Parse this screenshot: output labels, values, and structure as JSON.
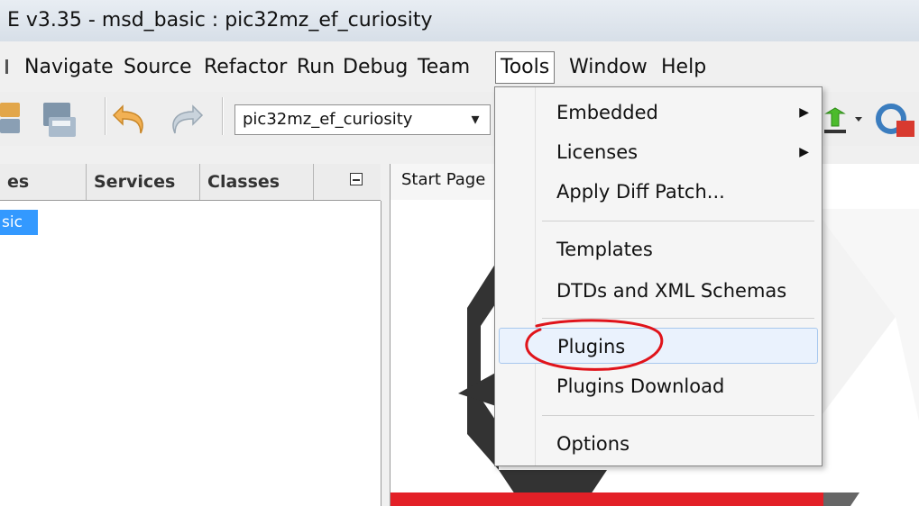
{
  "window": {
    "title": "E v3.35 - msd_basic : pic32mz_ef_curiosity"
  },
  "menubar": {
    "items": [
      {
        "label": "Navigate"
      },
      {
        "label": "Source"
      },
      {
        "label": "Refactor"
      },
      {
        "label": "Run"
      },
      {
        "label": "Debug"
      },
      {
        "label": "Team"
      },
      {
        "label": "Tools"
      },
      {
        "label": "Window"
      },
      {
        "label": "Help"
      }
    ],
    "active": "Tools"
  },
  "toolbar": {
    "configuration_value": "pic32mz_ef_curiosity",
    "configuration_arrow": "▾"
  },
  "left_panel": {
    "tabs": [
      {
        "label": "es"
      },
      {
        "label": "Services"
      },
      {
        "label": "Classes"
      }
    ],
    "selected_node": "sic"
  },
  "editor": {
    "tab_label": "Start Page"
  },
  "tools_menu": {
    "items": [
      {
        "label": "Embedded",
        "submenu": true
      },
      {
        "label": "Licenses",
        "submenu": true
      },
      {
        "label": "Apply Diff Patch...",
        "submenu": false
      },
      {
        "label": "Templates",
        "submenu": false
      },
      {
        "label": "DTDs and XML Schemas",
        "submenu": false
      },
      {
        "label": "Plugins",
        "submenu": false,
        "highlighted": true
      },
      {
        "label": "Plugins Download",
        "submenu": false
      },
      {
        "label": "Options",
        "submenu": false
      }
    ],
    "submenu_glyph": "▶"
  },
  "annotation": {
    "color": "#e0141b",
    "target": "Plugins"
  },
  "colors": {
    "selection": "#3399ff",
    "menu_hover": "#eaf2fd",
    "start_page_red": "#e32027"
  }
}
